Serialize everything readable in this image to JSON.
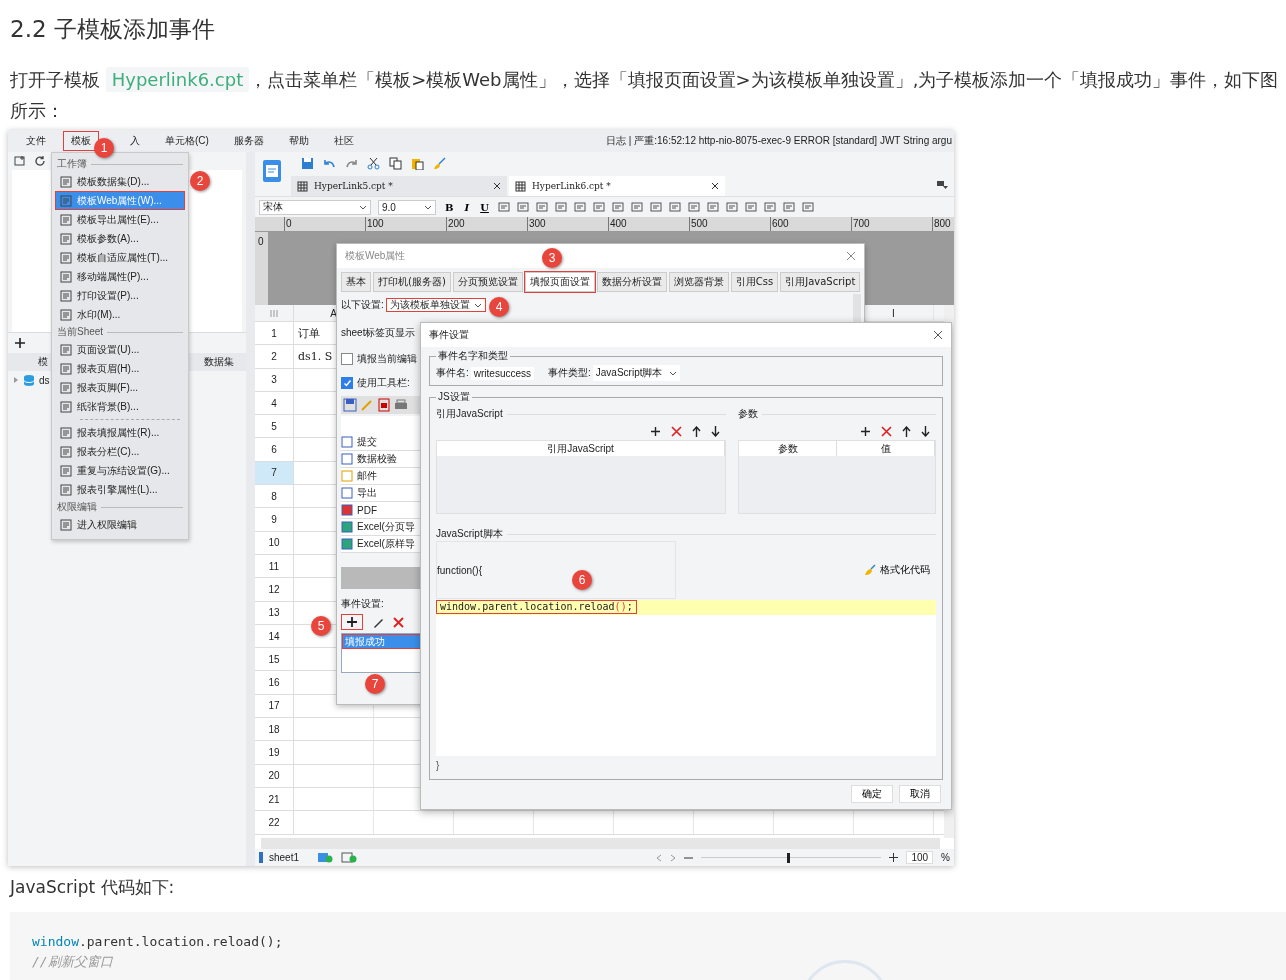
{
  "heading": "2.2 子模板添加事件",
  "intro": {
    "before": "打开子模板 ",
    "link": "Hyperlink6.cpt",
    "after": "，点击菜单栏「模板>模板Web属性」，选择「填报页面设置>为该模板单独设置」,为子模板添加一个「填报成功」事件，如下图所示："
  },
  "designer": {
    "menu_bar": [
      {
        "label": "文件",
        "selected": false
      },
      {
        "label": "模板",
        "selected": true
      },
      {
        "label": "入",
        "selected": false
      },
      {
        "label": "单元格(C)",
        "selected": false
      },
      {
        "label": "服务器",
        "selected": false
      },
      {
        "label": "帮助",
        "selected": false
      },
      {
        "label": "社区",
        "selected": false
      }
    ],
    "log_message": "日志 | 严重:16:52:12 http-nio-8075-exec-9 ERROR [standard] JWT String argu",
    "template_menu": [
      {
        "title": "工作簿",
        "items": [
          {
            "label": "模板数据集(D)...",
            "selected": false
          },
          {
            "label": "模板Web属性(W)...",
            "selected": true
          },
          {
            "label": "模板导出属性(E)...",
            "selected": false
          },
          {
            "label": "模板参数(A)...",
            "selected": false
          },
          {
            "label": "模板自适应属性(T)...",
            "selected": false
          },
          {
            "label": "移动端属性(P)...",
            "selected": false
          },
          {
            "label": "打印设置(P)...",
            "selected": false
          },
          {
            "label": "水印(M)...",
            "selected": false
          }
        ]
      },
      {
        "title": "当前Sheet",
        "items": [
          {
            "label": "页面设置(U)...",
            "selected": false
          },
          {
            "label": "报表页眉(H)...",
            "selected": false
          },
          {
            "label": "报表页脚(F)...",
            "selected": false
          },
          {
            "label": "纸张背景(B)...",
            "selected": false
          }
        ]
      },
      {
        "items": [
          {
            "label": "报表填报属性(R)...",
            "selected": false
          },
          {
            "label": "报表分栏(C)...",
            "selected": false
          },
          {
            "label": "重复与冻结设置(G)...",
            "selected": false
          },
          {
            "label": "报表引擎属性(L)...",
            "selected": false
          }
        ]
      },
      {
        "title": "权限编辑",
        "items": [
          {
            "label": "进入权限编辑",
            "selected": false
          }
        ]
      }
    ],
    "tree": {
      "header_left": "模",
      "header_right": "数据集",
      "item": "ds"
    },
    "file_tabs": [
      {
        "label": "HyperLink5.cpt *",
        "selected": false
      },
      {
        "label": "HyperLink6.cpt *",
        "selected": true
      }
    ],
    "font_name": "宋体",
    "font_size": "9.0",
    "format_buttons": [
      "B",
      "I",
      "U"
    ],
    "ruler_ticks": [
      "0",
      "100",
      "200",
      "300",
      "400",
      "500",
      "600",
      "700",
      "800"
    ],
    "vertical_ruler": "0",
    "column_headers": [
      "A",
      "I"
    ],
    "rows": [
      {
        "label": "1",
        "selected": false
      },
      {
        "label": "2",
        "selected": false
      },
      {
        "label": "3",
        "selected": false
      },
      {
        "label": "4",
        "selected": false
      },
      {
        "label": "5",
        "selected": false
      },
      {
        "label": "6",
        "selected": false
      },
      {
        "label": "7",
        "selected": true
      },
      {
        "label": "8",
        "selected": false
      },
      {
        "label": "9",
        "selected": false
      },
      {
        "label": "10",
        "selected": false
      },
      {
        "label": "11",
        "selected": false
      },
      {
        "label": "12",
        "selected": false
      },
      {
        "label": "13",
        "selected": false
      },
      {
        "label": "14",
        "selected": false
      },
      {
        "label": "15",
        "selected": false
      },
      {
        "label": "16",
        "selected": false
      },
      {
        "label": "17",
        "selected": false
      },
      {
        "label": "18",
        "selected": false
      },
      {
        "label": "19",
        "selected": false
      },
      {
        "label": "20",
        "selected": false
      },
      {
        "label": "21",
        "selected": false
      },
      {
        "label": "22",
        "selected": false
      }
    ],
    "cells": [
      "订单",
      "ds1. S"
    ],
    "web_dialog": {
      "title": "模板Web属性",
      "tabs": [
        {
          "label": "基本",
          "selected": false
        },
        {
          "label": "打印机(服务器)",
          "selected": false
        },
        {
          "label": "分页预览设置",
          "selected": false
        },
        {
          "label": "填报页面设置",
          "selected": true
        },
        {
          "label": "数据分析设置",
          "selected": false
        },
        {
          "label": "浏览器背景",
          "selected": false
        },
        {
          "label": "引用Css",
          "selected": false
        },
        {
          "label": "引用JavaScript",
          "selected": false
        }
      ],
      "setting_label": "以下设置:",
      "setting_value": "为该模板单独设置",
      "sheet_label": "sheet标签页显示",
      "options": [
        {
          "label": "填报当前编辑",
          "checked": false
        },
        {
          "label": "使用工具栏:",
          "checked": true
        }
      ],
      "toolbar_buttons": [
        "提交",
        "数据校验",
        "邮件",
        "导出",
        "PDF",
        "Excel(分页导",
        "Excel(原样导"
      ],
      "event_label": "事件设置:",
      "events": [
        {
          "label": "填报成功",
          "selected": true
        }
      ]
    },
    "event_dialog": {
      "title": "事件设置",
      "name_group": "事件名字和类型",
      "name_label": "事件名:",
      "name_value": "writesuccess",
      "type_label": "事件类型:",
      "type_value": "JavaScript脚本",
      "js_group": "JS设置",
      "ref_title": "引用JavaScript",
      "ref_column": "引用JavaScript",
      "params_title": "参数",
      "param_columns": [
        "参数",
        "值"
      ],
      "script_title": "JavaScript脚本",
      "function_open": "function(){",
      "format_button": "格式化代码",
      "code": [
        {
          "text": "window.parent.location.reload",
          "kind": "plain"
        },
        {
          "text": "()",
          "kind": "paren"
        },
        {
          "text": ";",
          "kind": "plain"
        }
      ],
      "function_close": "}",
      "buttons": [
        "确定",
        "取消"
      ]
    },
    "status": {
      "sheet": "sheet1",
      "zoom_slider": {
        "level": 0.48
      },
      "zoom": "100",
      "unit": "%"
    },
    "callouts": [
      "1",
      "2",
      "3",
      "4",
      "5",
      "6",
      "7"
    ]
  },
  "code_intro": "JavaScript 代码如下:",
  "code_block": {
    "line": [
      {
        "text": "window",
        "kind": "object"
      },
      {
        "text": ".parent.location.reload();",
        "kind": "plain"
      }
    ],
    "comment": "//刷新父窗口"
  }
}
